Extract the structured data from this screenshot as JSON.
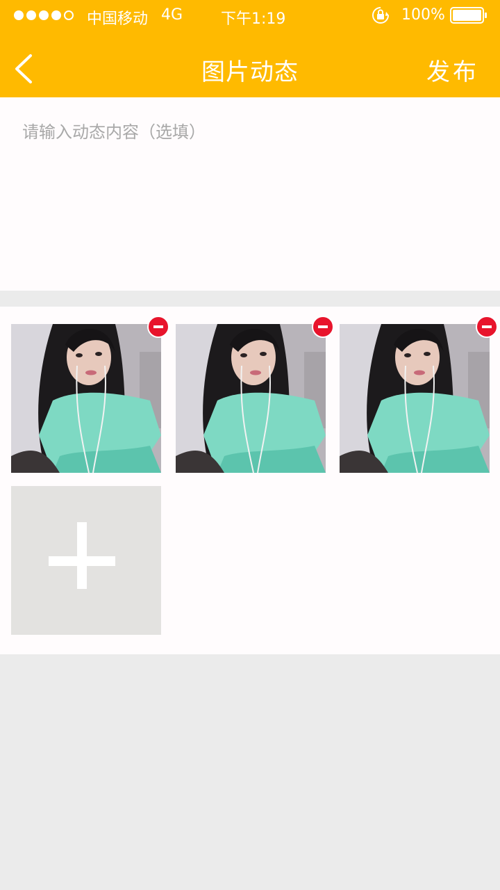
{
  "status_bar": {
    "carrier": "中国移动",
    "network": "4G",
    "time": "下午1:19",
    "battery": "100%",
    "signal_icon": "signal-dots-icon",
    "rotation_lock_icon": "rotation-lock-icon",
    "battery_icon": "battery-icon"
  },
  "nav": {
    "back_icon": "chevron-left-icon",
    "title": "图片动态",
    "publish_label": "发布"
  },
  "compose": {
    "placeholder": "请输入动态内容（选填）"
  },
  "photos": {
    "items": [
      {
        "type": "photo"
      },
      {
        "type": "photo"
      },
      {
        "type": "photo"
      }
    ],
    "remove_icon": "minus-circle-icon",
    "add_icon": "plus-icon"
  },
  "colors": {
    "accent": "#ffba00",
    "remove": "#e8142c",
    "background": "#ebebeb",
    "panel": "#fffcfd"
  }
}
